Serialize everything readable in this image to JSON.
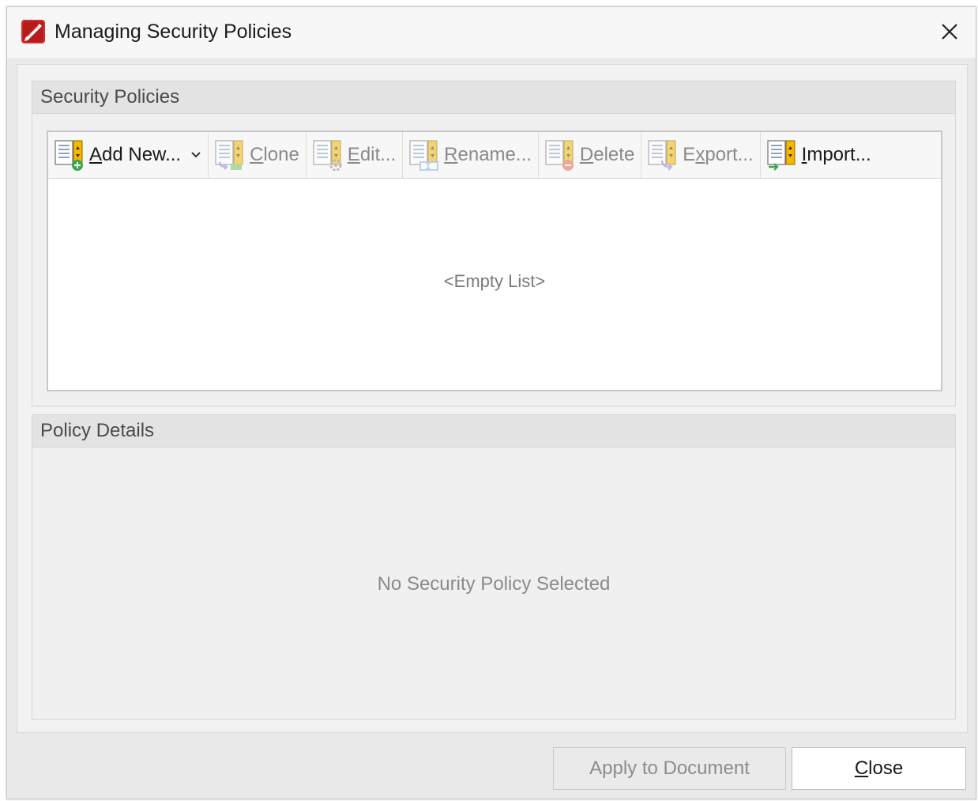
{
  "window": {
    "title": "Managing Security Policies"
  },
  "security_policies": {
    "header": "Security Policies",
    "toolbar": [
      {
        "id": "add-new",
        "pre": "",
        "u": "A",
        "post": "dd New...",
        "enabled": true,
        "icon": "add-policy-icon",
        "has_dropdown": true
      },
      {
        "id": "clone",
        "pre": "",
        "u": "C",
        "post": "lone",
        "enabled": false,
        "icon": "clone-policy-icon"
      },
      {
        "id": "edit",
        "pre": "",
        "u": "E",
        "post": "dit...",
        "enabled": false,
        "icon": "edit-policy-icon"
      },
      {
        "id": "rename",
        "pre": "",
        "u": "R",
        "post": "ename...",
        "enabled": false,
        "icon": "rename-policy-icon"
      },
      {
        "id": "delete",
        "pre": "",
        "u": "D",
        "post": "elete",
        "enabled": false,
        "icon": "delete-policy-icon"
      },
      {
        "id": "export",
        "pre": "E",
        "u": "x",
        "post": "port...",
        "enabled": false,
        "icon": "export-policy-icon"
      },
      {
        "id": "import",
        "pre": "",
        "u": "I",
        "post": "mport...",
        "enabled": true,
        "icon": "import-policy-icon"
      }
    ],
    "empty_text": "<Empty List>"
  },
  "policy_details": {
    "header": "Policy Details",
    "empty_text": "No Security Policy Selected"
  },
  "footer": {
    "apply_label": "Apply to Document",
    "close_u": "C",
    "close_post": "lose"
  },
  "colors": {
    "brand_red": "#d32f2f",
    "accent_yellow": "#f5b800",
    "green": "#3aa84a",
    "purple": "#9a7ad8"
  }
}
